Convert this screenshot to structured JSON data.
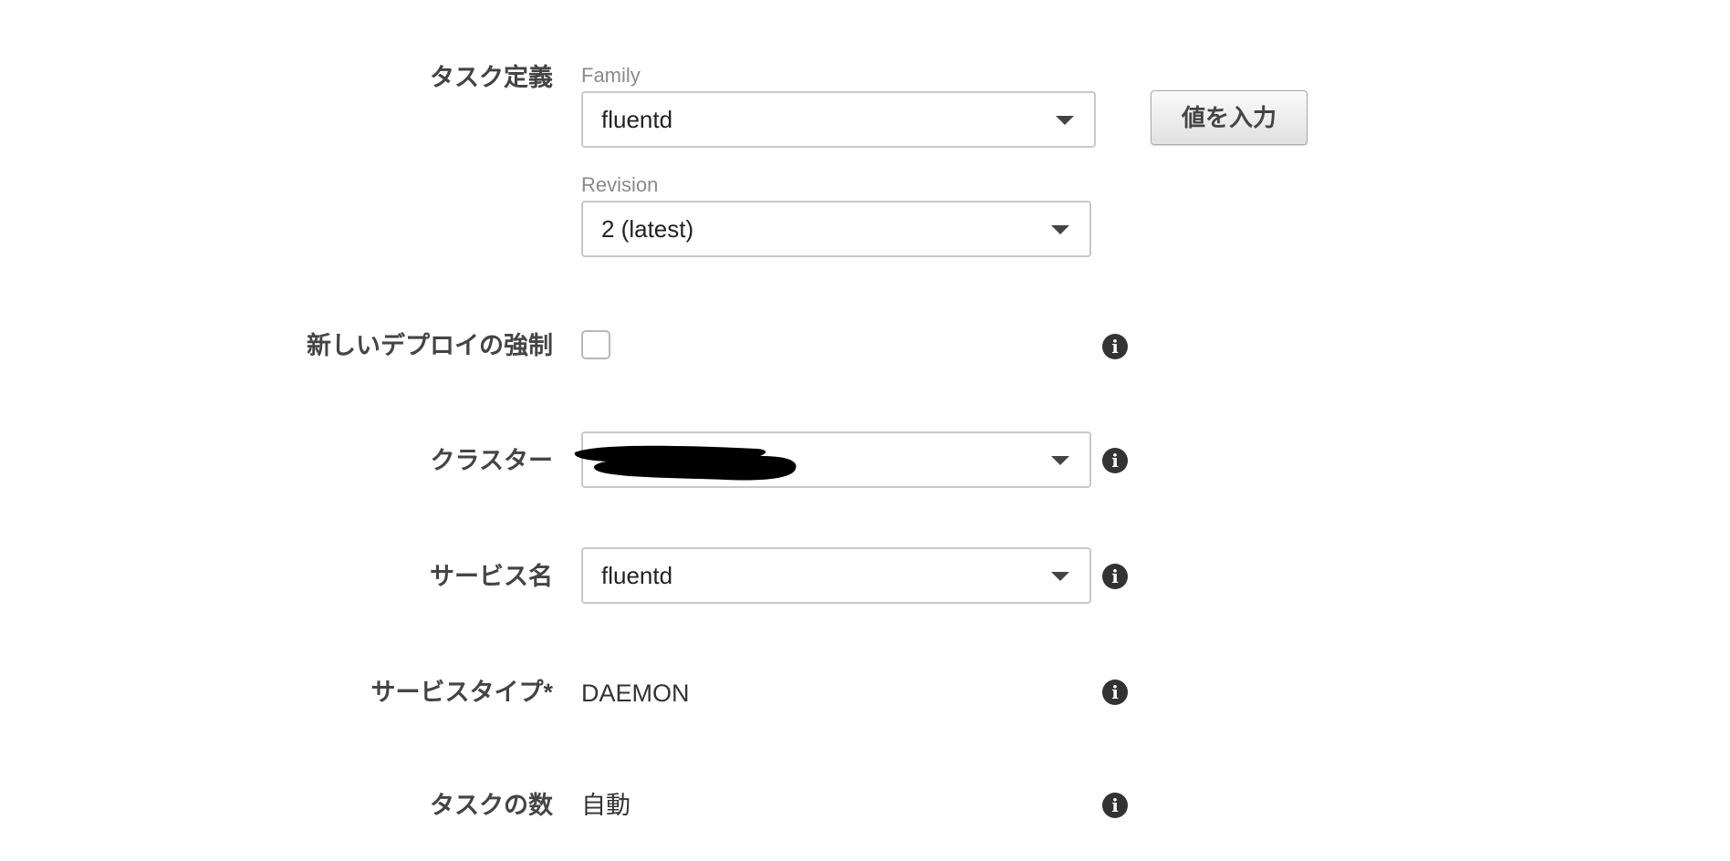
{
  "task_definition": {
    "label": "タスク定義",
    "family": {
      "label": "Family",
      "value": "fluentd"
    },
    "revision": {
      "label": "Revision",
      "value": "2 (latest)"
    },
    "enter_value_button": "値を入力"
  },
  "force_new_deployment": {
    "label": "新しいデプロイの強制",
    "checked": false
  },
  "cluster": {
    "label": "クラスター",
    "value": ""
  },
  "service_name": {
    "label": "サービス名",
    "value": "fluentd"
  },
  "service_type": {
    "label": "サービスタイプ*",
    "value": "DAEMON"
  },
  "number_of_tasks": {
    "label": "タスクの数",
    "value": "自動"
  },
  "icons": {
    "info": "info-icon",
    "caret": "caret-down-icon"
  }
}
